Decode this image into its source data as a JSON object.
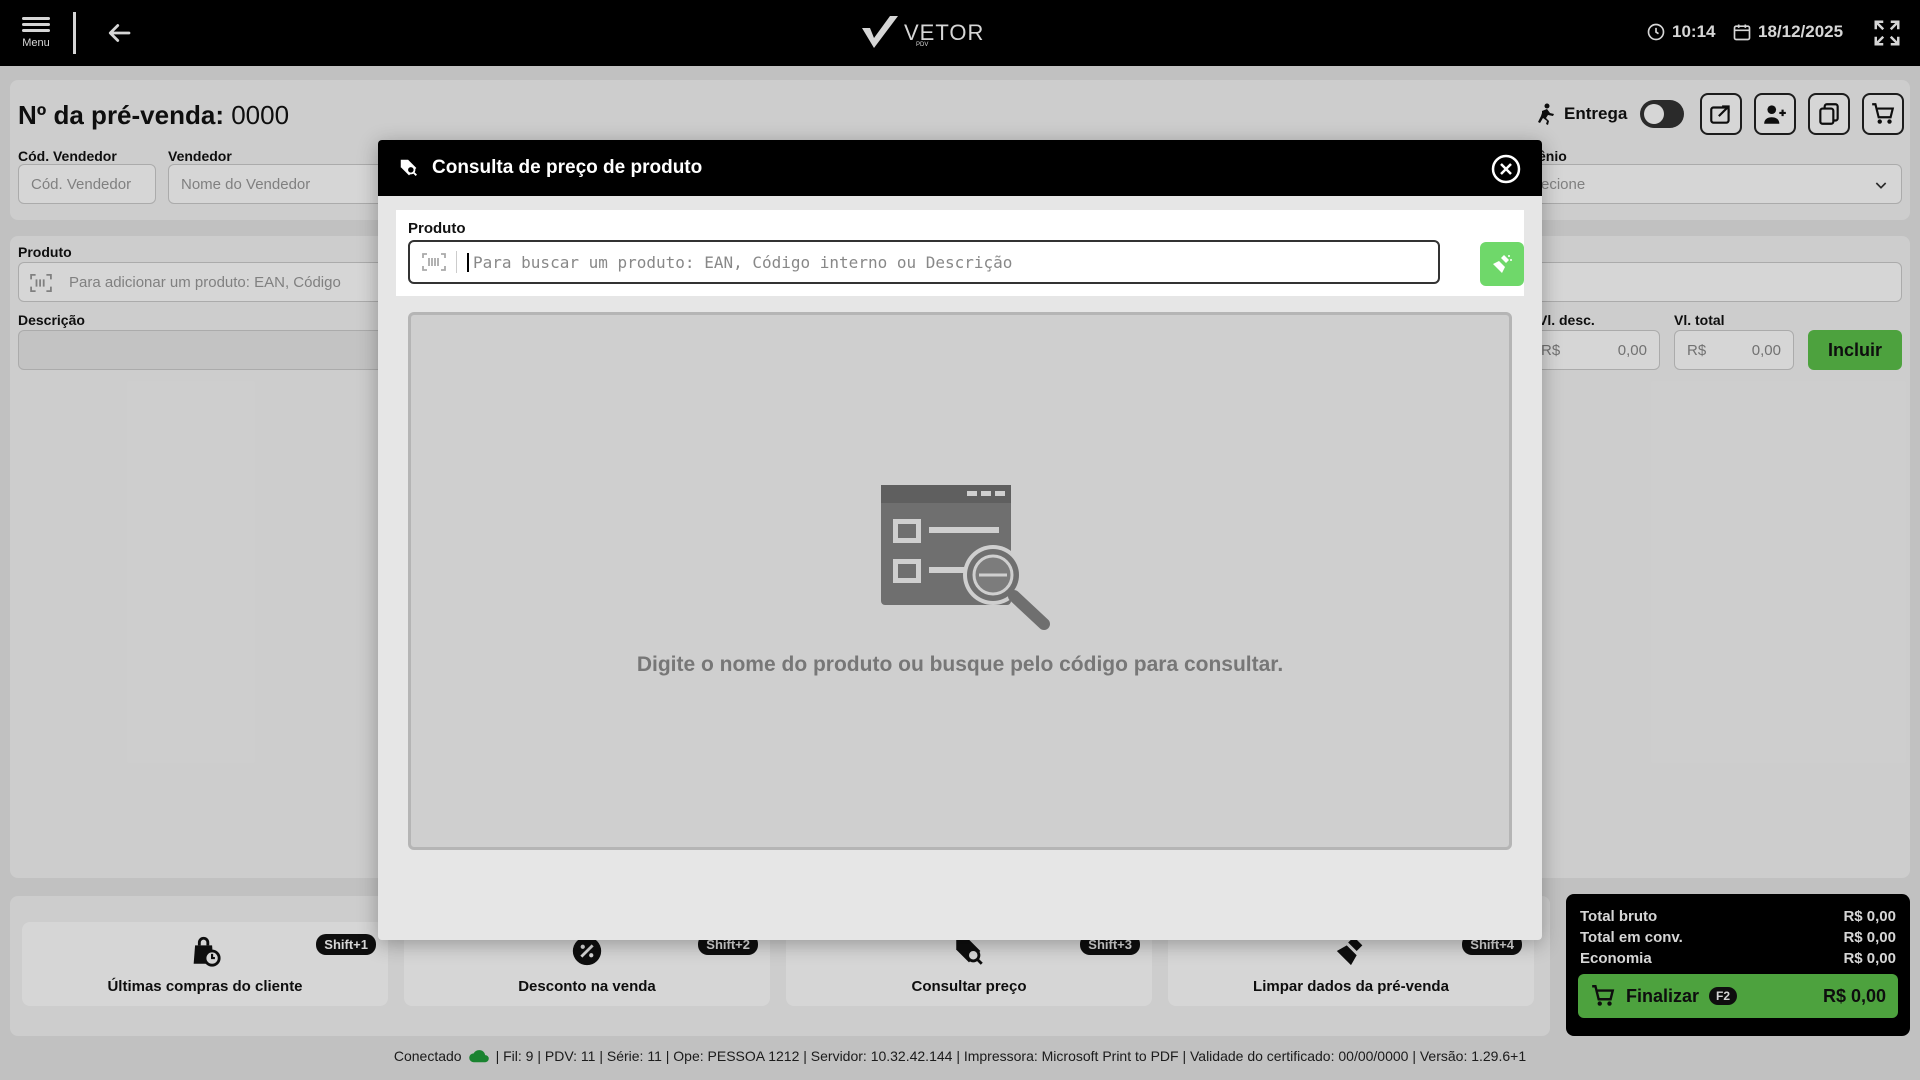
{
  "topbar": {
    "menu_label": "Menu",
    "brand": "VETOR",
    "brand_sub": "PDV",
    "time": "10:14",
    "date": "18/12/2025"
  },
  "header": {
    "title_label": "Nº da pré-venda:",
    "title_number": "0000",
    "cod_vendedor_label": "Cód. Vendedor",
    "cod_vendedor_placeholder": "Cód. Vendedor",
    "vendedor_label": "Vendedor",
    "vendedor_placeholder": "Nome do Vendedor",
    "convenio_label": "ênio",
    "convenio_value": "ecione",
    "entrega_label": "Entrega"
  },
  "product": {
    "produto_label": "Produto",
    "produto_placeholder": "Para adicionar um produto: EAN, Código",
    "descricao_label": "Descrição",
    "vl_desc_label": "Vl. desc.",
    "vl_total_label": "Vl. total",
    "currency": "R$",
    "vl_desc_value": "0,00",
    "vl_total_value": "0,00",
    "incluir_label": "Incluir"
  },
  "actions": [
    {
      "label": "Últimas compras do cliente",
      "shortcut": "Shift+1"
    },
    {
      "label": "Desconto na venda",
      "shortcut": "Shift+2"
    },
    {
      "label": "Consultar preço",
      "shortcut": "Shift+3"
    },
    {
      "label": "Limpar dados da pré-venda",
      "shortcut": "Shift+4"
    }
  ],
  "totals": {
    "bruto_label": "Total bruto",
    "bruto_value": "R$ 0,00",
    "conv_label": "Total em conv.",
    "conv_value": "R$ 0,00",
    "economia_label": "Economia",
    "economia_value": "R$ 0,00",
    "finalizar_label": "Finalizar",
    "finalizar_key": "F2",
    "finalizar_value": "R$ 0,00"
  },
  "status": {
    "conectado": "Conectado",
    "info": "| Fil: 9 | PDV: 11 | Série: 11 | Ope: PESSOA 1212 | Servidor: 10.32.42.144 | Impressora: Microsoft Print to PDF | Validade do certificado: 00/00/0000 | Versão: 1.29.6+1"
  },
  "modal": {
    "title": "Consulta de preço de produto",
    "produto_label": "Produto",
    "search_placeholder": "Para buscar um produto: EAN, Código interno ou Descrição",
    "search_value": "",
    "empty_message": "Digite o nome do produto ou busque pelo código para consultar."
  },
  "colors": {
    "accent_green": "#5cc24a",
    "dark": "#000000"
  }
}
